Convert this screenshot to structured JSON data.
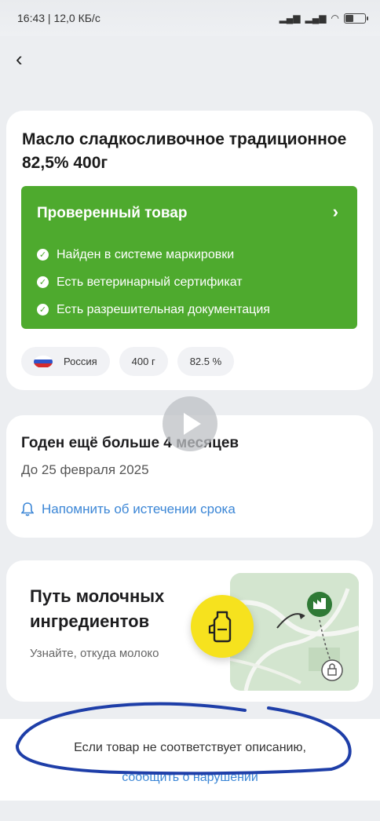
{
  "status_bar": {
    "left": "16:43 | 12,0 КБ/с",
    "battery": "51"
  },
  "product": {
    "title": "Масло сладкосливочное традиционное 82,5% 400г",
    "verified": {
      "title": "Проверенный товар",
      "items": [
        "Найден в системе маркировки",
        "Есть ветеринарный сертификат",
        "Есть разрешительная документация"
      ]
    },
    "chips": [
      "Россия",
      "400 г",
      "82.5 %"
    ]
  },
  "expiry": {
    "title": "Годен ещё больше 4 месяцев",
    "date": "До 25 февраля 2025",
    "remind": "Напомнить об истечении срока"
  },
  "path": {
    "title": "Путь молочных ингредиентов",
    "subtitle": "Узнайте, откуда молоко"
  },
  "report": {
    "text": "Если товар не соответствует описанию,",
    "link": "сообщить о нарушении"
  },
  "colors": {
    "verified_green": "#4eaa2e",
    "link_blue": "#3b86d6",
    "milk_yellow": "#f6e21e",
    "scribble_blue": "#1e3ea8"
  }
}
